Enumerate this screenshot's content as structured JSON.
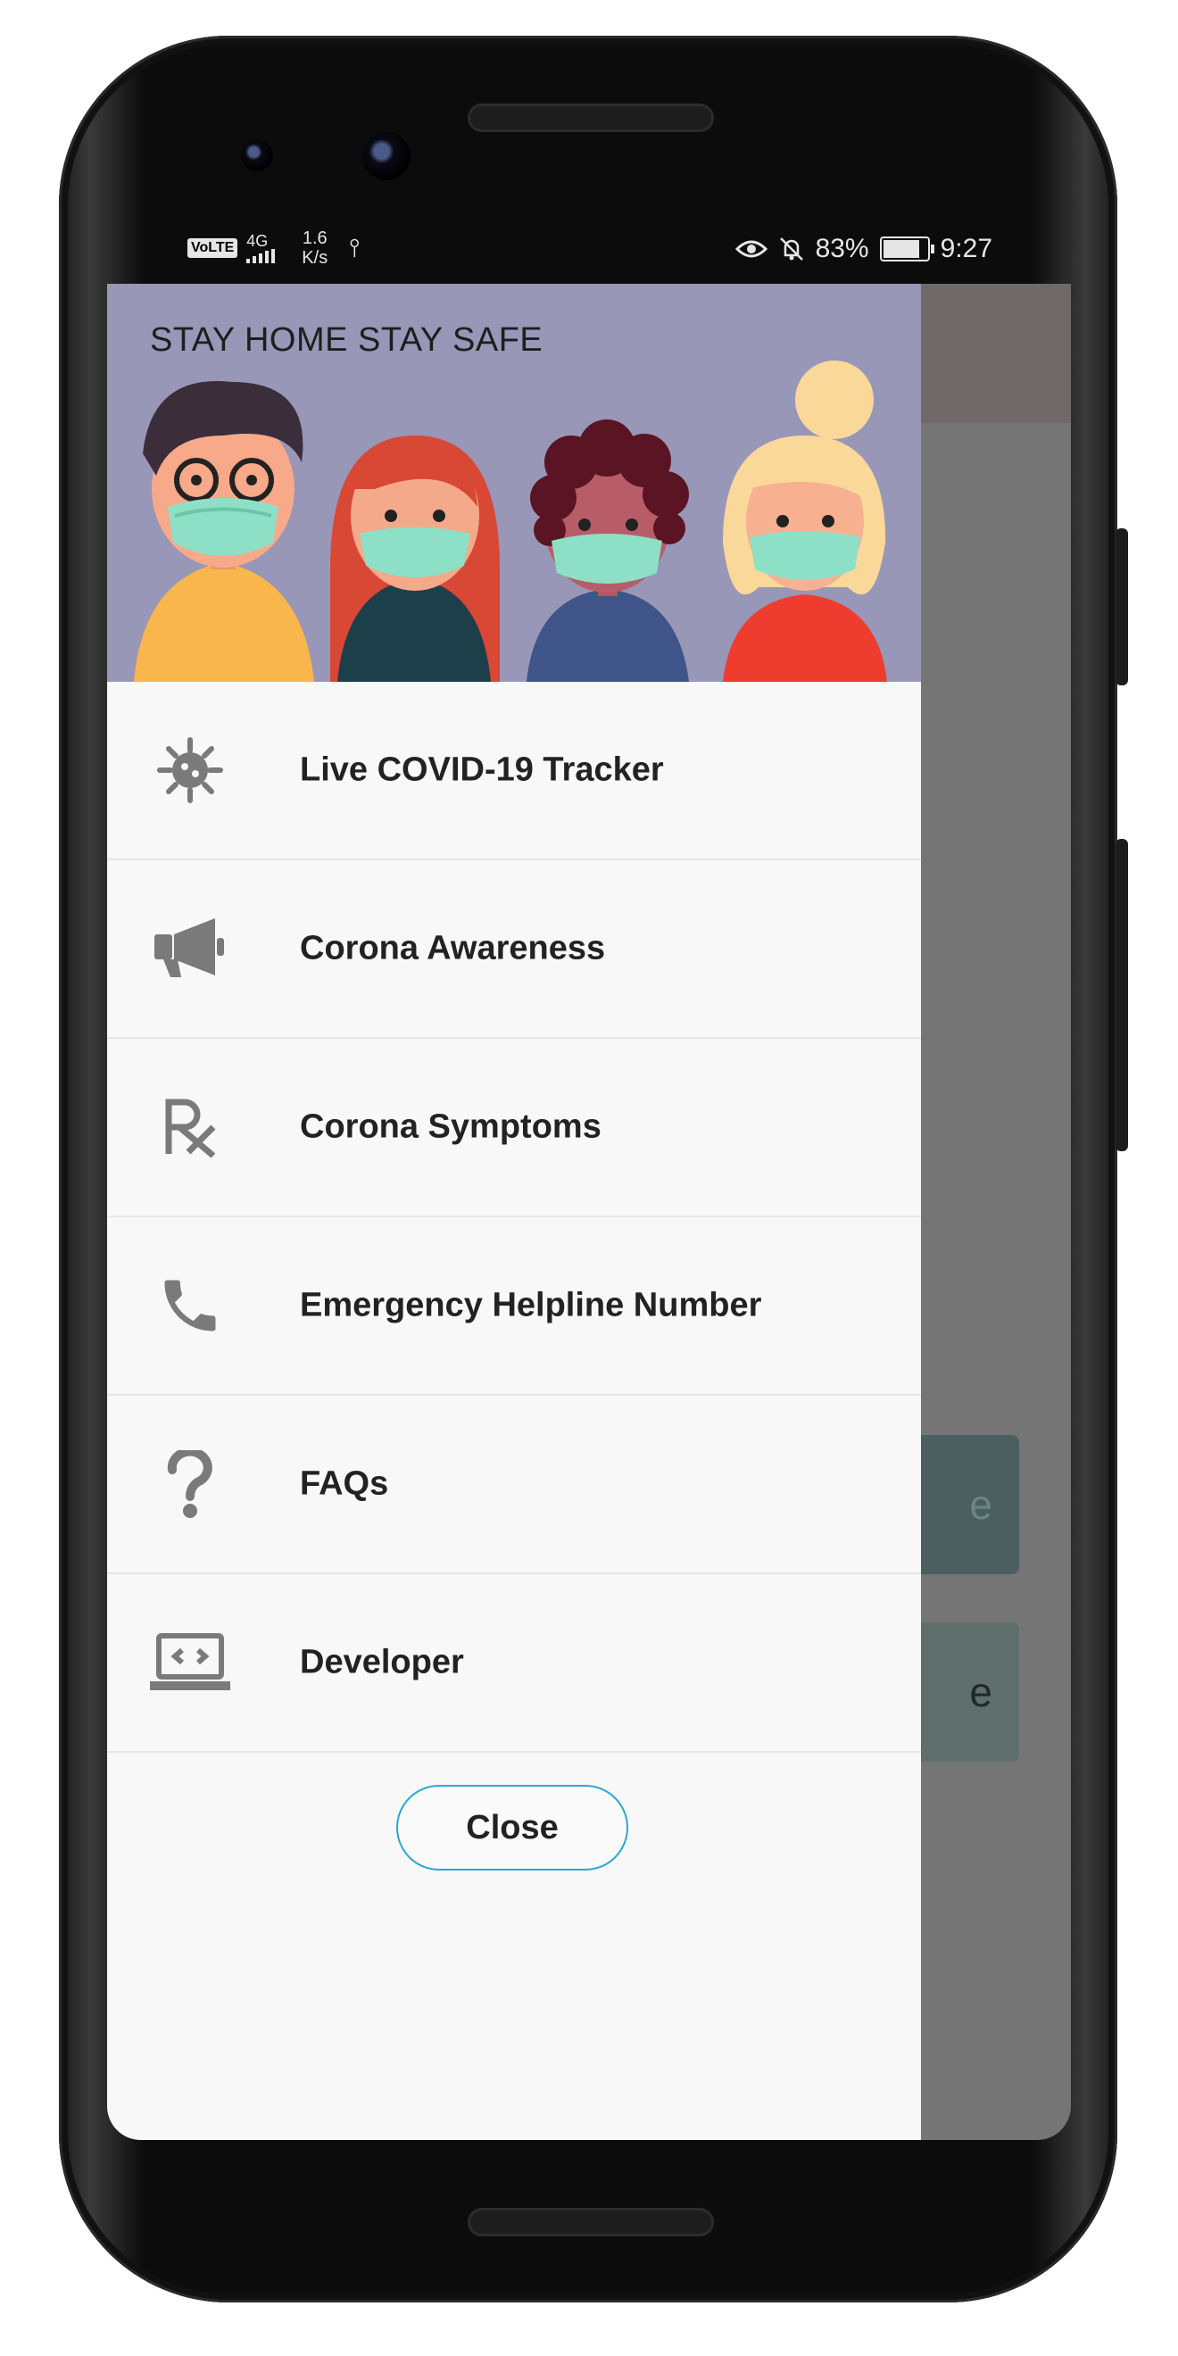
{
  "status_bar": {
    "volte": "VoLTE",
    "network": "4G",
    "speed_value": "1.6",
    "speed_unit": "K/s",
    "battery": "83%",
    "time": "9:27"
  },
  "drawer": {
    "header_text": "STAY HOME STAY SAFE",
    "items": [
      {
        "label": "Live COVID-19 Tracker",
        "icon": "virus-icon"
      },
      {
        "label": "Corona Awareness",
        "icon": "megaphone-icon"
      },
      {
        "label": "Corona Symptoms",
        "icon": "prescription-icon"
      },
      {
        "label": "Emergency Helpline Number",
        "icon": "phone-icon"
      },
      {
        "label": "FAQs",
        "icon": "question-icon"
      },
      {
        "label": "Developer",
        "icon": "laptop-code-icon"
      }
    ],
    "close_label": "Close"
  },
  "background": {
    "card_1_text": "e",
    "card_2_text": "e"
  },
  "colors": {
    "header_bg": "#9897b8",
    "drawer_bg": "#f8f8f8",
    "scrim": "#757575",
    "close_border": "#2aa7d9",
    "icon": "#7a7a7a"
  }
}
